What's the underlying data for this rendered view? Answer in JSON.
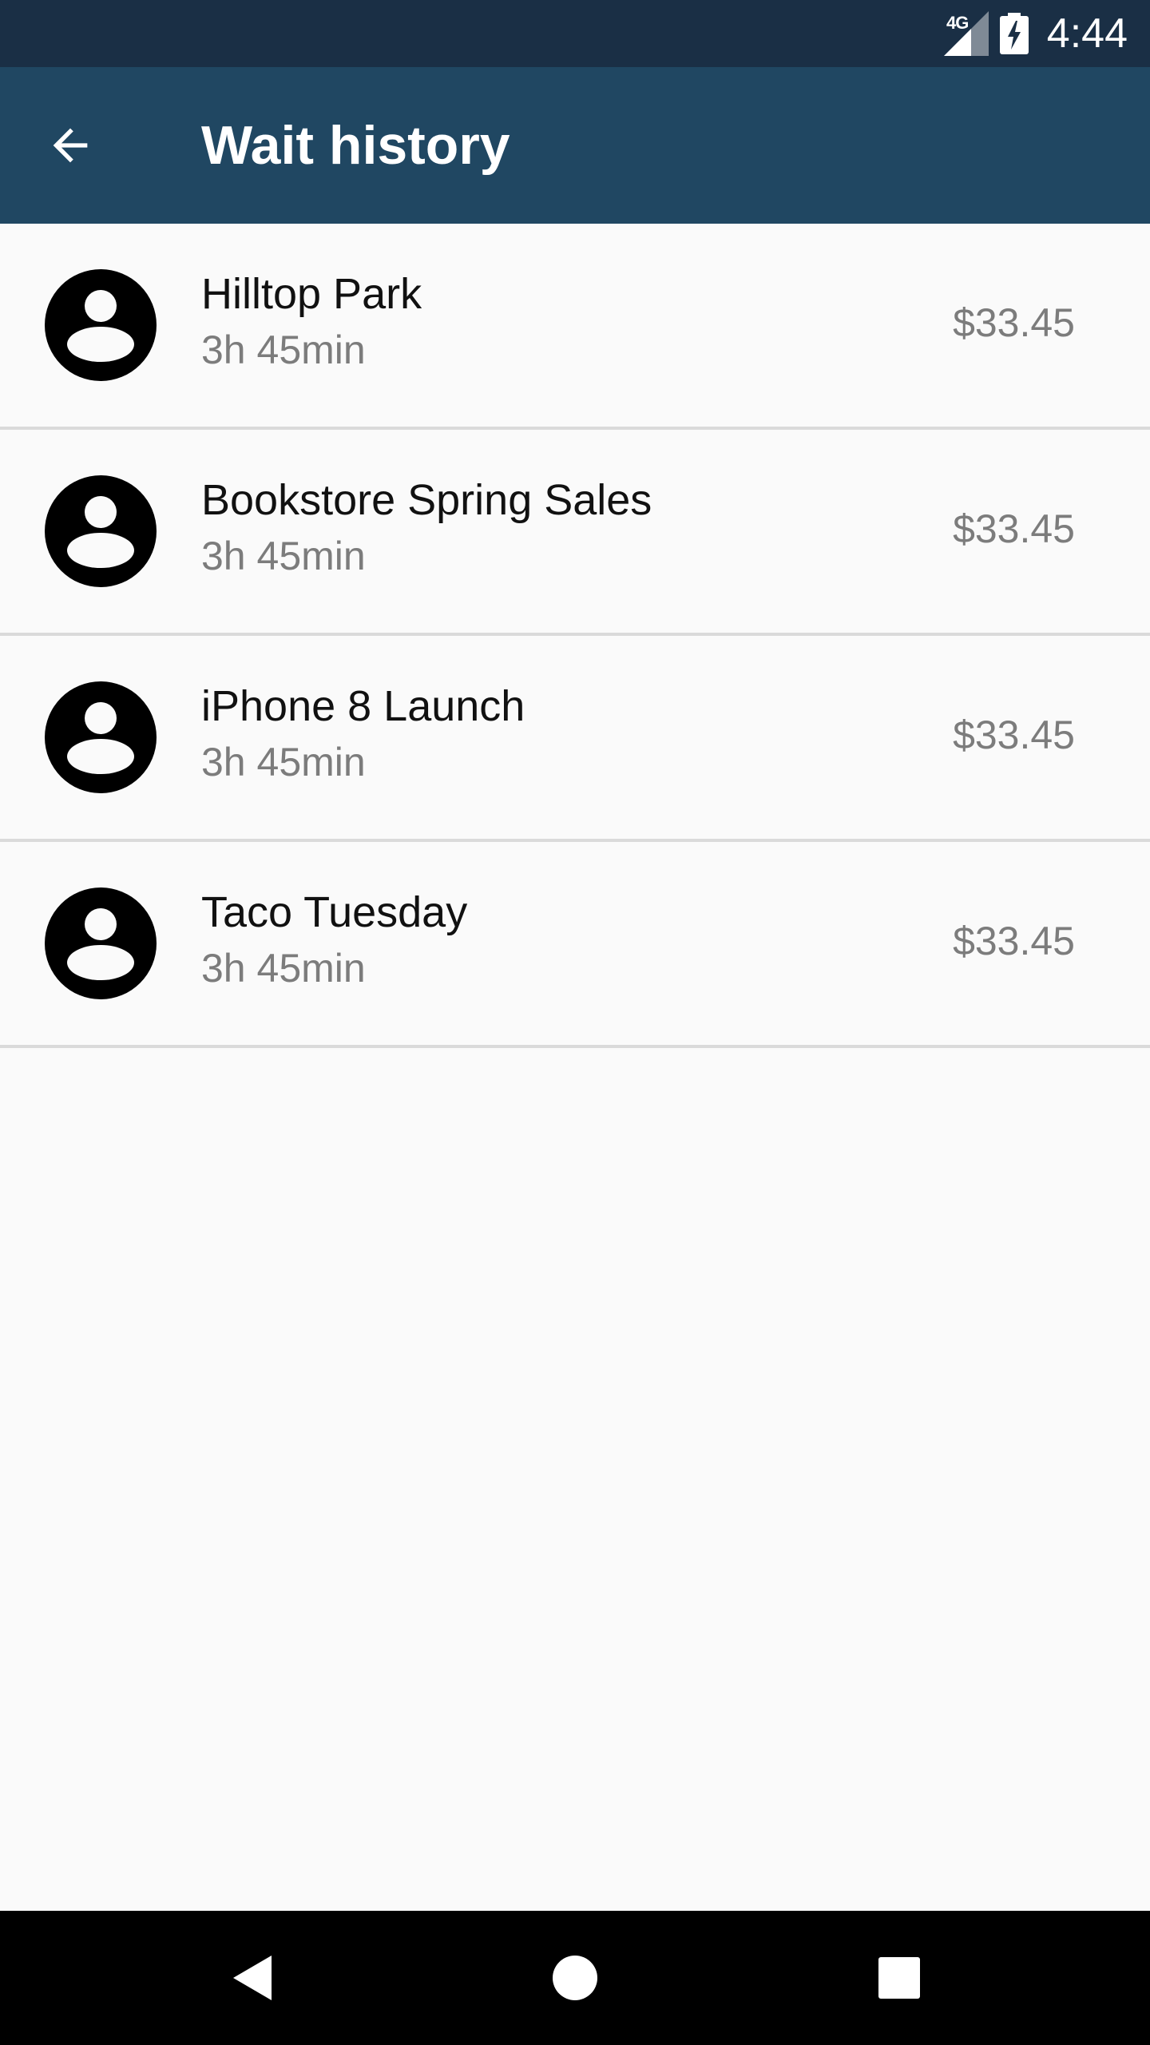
{
  "status_bar": {
    "network": "4G",
    "time": "4:44"
  },
  "app_bar": {
    "title": "Wait history",
    "back_icon": "arrow-back-icon"
  },
  "history": {
    "items": [
      {
        "title": "Hilltop Park",
        "duration": "3h 45min",
        "price": "$33.45",
        "icon": "account-circle-icon"
      },
      {
        "title": "Bookstore Spring Sales",
        "duration": "3h 45min",
        "price": "$33.45",
        "icon": "account-circle-icon"
      },
      {
        "title": "iPhone 8 Launch",
        "duration": "3h 45min",
        "price": "$33.45",
        "icon": "account-circle-icon"
      },
      {
        "title": "Taco Tuesday",
        "duration": "3h 45min",
        "price": "$33.45",
        "icon": "account-circle-icon"
      }
    ]
  },
  "nav_bar": {
    "back_icon": "nav-back-triangle-icon",
    "home_icon": "nav-home-circle-icon",
    "recents_icon": "nav-recents-square-icon"
  },
  "colors": {
    "status_bar": "#1a2f45",
    "app_bar": "#204762",
    "background": "#fafafa",
    "divider": "#dadada",
    "secondary_text": "#7c7c7c"
  }
}
